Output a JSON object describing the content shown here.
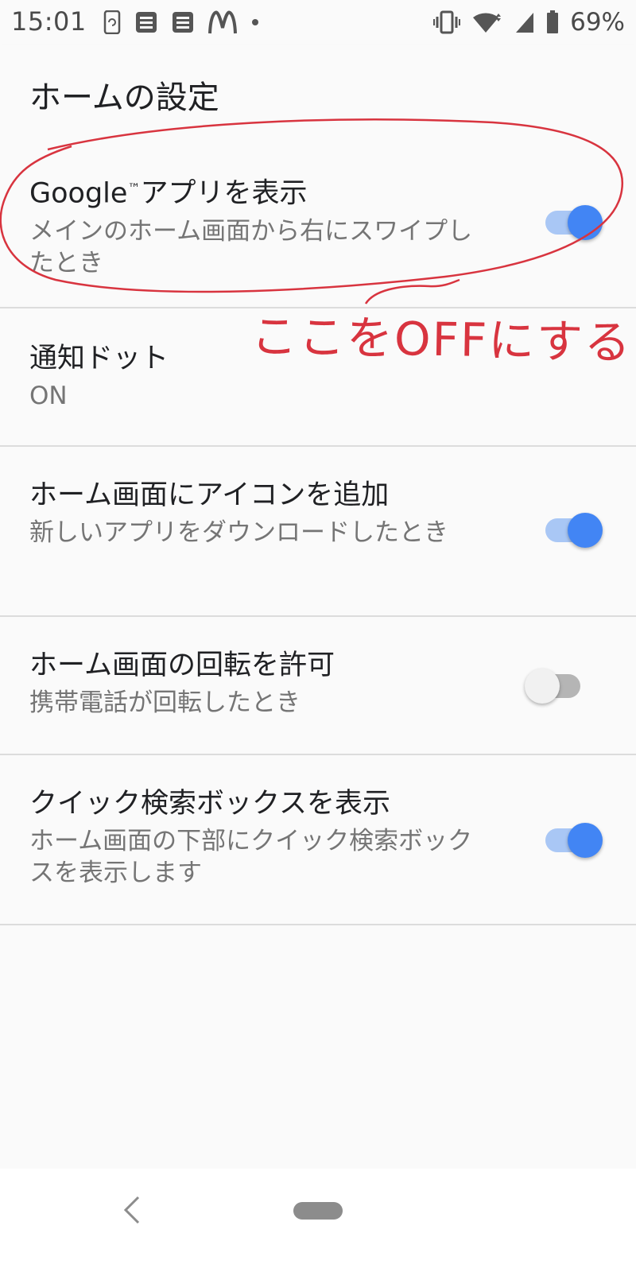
{
  "status_bar": {
    "time": "15:01",
    "battery_percent": "69%",
    "left_icons": [
      "rotate-icon",
      "note-icon",
      "note-icon",
      "mcdonalds-icon",
      "dot-icon"
    ],
    "right_icons": [
      "vibrate-icon",
      "wifi-icon",
      "signal-icon",
      "battery-icon"
    ]
  },
  "app_bar": {
    "title": "ホームの設定"
  },
  "settings": [
    {
      "title_prefix": "Google",
      "title_tm": "™",
      "title_suffix": "アプリを表示",
      "summary": "メインのホーム画面から右にスワイプしたとき",
      "toggle": "on"
    },
    {
      "title": "通知ドット",
      "summary": "ON"
    },
    {
      "title": "ホーム画面にアイコンを追加",
      "summary": "新しいアプリをダウンロードしたとき",
      "toggle": "on"
    },
    {
      "title": "ホーム画面の回転を許可",
      "summary": "携帯電話が回転したとき",
      "toggle": "off"
    },
    {
      "title": "クイック検索ボックスを表示",
      "summary": "ホーム画面の下部にクイック検索ボックスを表示します",
      "toggle": "on"
    }
  ],
  "annotation": {
    "text": "ここをOFFにする",
    "color": "#d8343f"
  },
  "colors": {
    "accent": "#4285f4",
    "accent_track": "#a9c7f5",
    "off_track": "#b5b5b5"
  },
  "nav_bar": {
    "icons": [
      "back-icon",
      "home-pill-icon"
    ]
  }
}
